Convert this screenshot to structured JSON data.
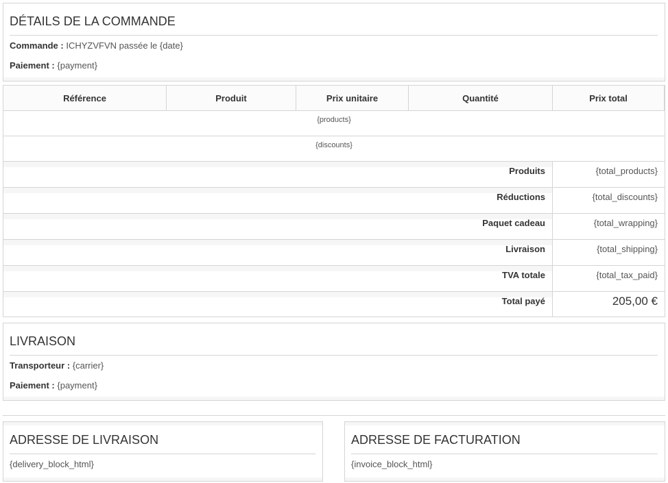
{
  "order_details": {
    "title": "DÉTAILS DE LA COMMANDE",
    "order_label": "Commande :",
    "order_value": "ICHYZVFVN passée le {date}",
    "payment_label": "Paiement :",
    "payment_value": "{payment}"
  },
  "table": {
    "headers": [
      "Référence",
      "Produit",
      "Prix unitaire",
      "Quantité",
      "Prix total"
    ],
    "products_placeholder": "{products}",
    "discounts_placeholder": "{discounts}",
    "totals": [
      {
        "label": "Produits",
        "value": "{total_products}"
      },
      {
        "label": "Réductions",
        "value": "{total_discounts}"
      },
      {
        "label": "Paquet cadeau",
        "value": "{total_wrapping}"
      },
      {
        "label": "Livraison",
        "value": "{total_shipping}"
      },
      {
        "label": "TVA totale",
        "value": "{total_tax_paid}"
      },
      {
        "label": "Total payé",
        "value": "205,00 €"
      }
    ]
  },
  "shipping": {
    "title": "LIVRAISON",
    "carrier_label": "Transporteur :",
    "carrier_value": "{carrier}",
    "payment_label": "Paiement :",
    "payment_value": "{payment}"
  },
  "delivery_address": {
    "title": "ADRESSE DE LIVRAISON",
    "content": "{delivery_block_html}"
  },
  "invoice_address": {
    "title": "ADRESSE DE FACTURATION",
    "content": "{invoice_block_html}"
  }
}
